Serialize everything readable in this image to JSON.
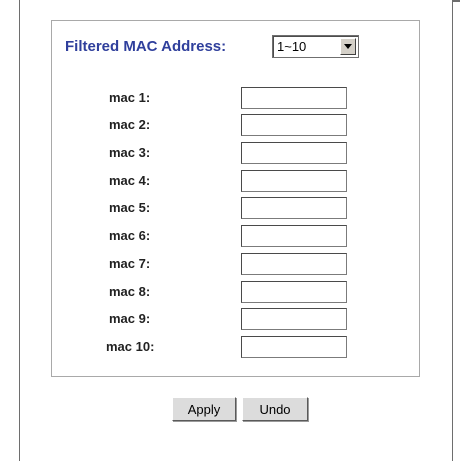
{
  "filter": {
    "label": "Filtered MAC Address:",
    "select_value": "1~10"
  },
  "mac_rows": [
    {
      "label": "mac 1:",
      "value": ""
    },
    {
      "label": "mac 2:",
      "value": ""
    },
    {
      "label": "mac 3:",
      "value": ""
    },
    {
      "label": "mac 4:",
      "value": ""
    },
    {
      "label": "mac 5:",
      "value": ""
    },
    {
      "label": "mac 6:",
      "value": ""
    },
    {
      "label": "mac 7:",
      "value": ""
    },
    {
      "label": "mac 8:",
      "value": ""
    },
    {
      "label": "mac 9:",
      "value": ""
    },
    {
      "label": "mac 10:",
      "value": ""
    }
  ],
  "buttons": {
    "apply_label": "Apply",
    "undo_label": "Undo"
  },
  "colors": {
    "label_blue": "#2f3f9c",
    "button_face": "#dcdcdc"
  }
}
